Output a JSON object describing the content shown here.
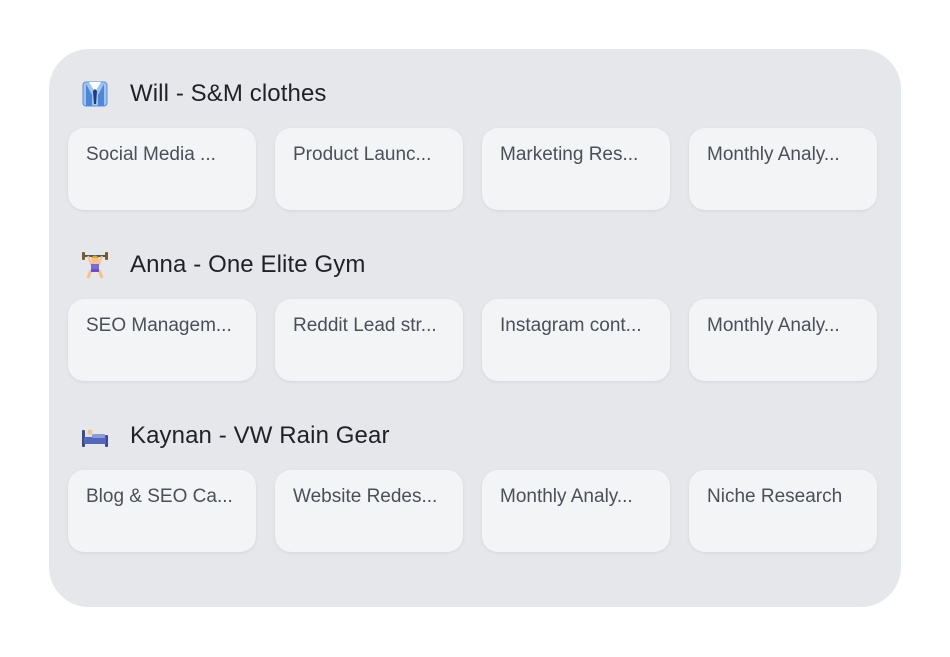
{
  "clients": [
    {
      "name": "Will - S&M clothes",
      "icon": "suit-jacket-icon",
      "projects": [
        "Social Media ...",
        "Product Launc...",
        "Marketing Res...",
        "Monthly Analy..."
      ]
    },
    {
      "name": "Anna - One Elite Gym",
      "icon": "weightlifter-icon",
      "projects": [
        "SEO Managem...",
        "Reddit Lead str...",
        "Instagram cont...",
        "Monthly Analy..."
      ]
    },
    {
      "name": "Kaynan - VW Rain Gear",
      "icon": "bed-icon",
      "projects": [
        "Blog & SEO Ca...",
        "Website Redes...",
        "Monthly Analy...",
        "Niche Research"
      ]
    }
  ]
}
